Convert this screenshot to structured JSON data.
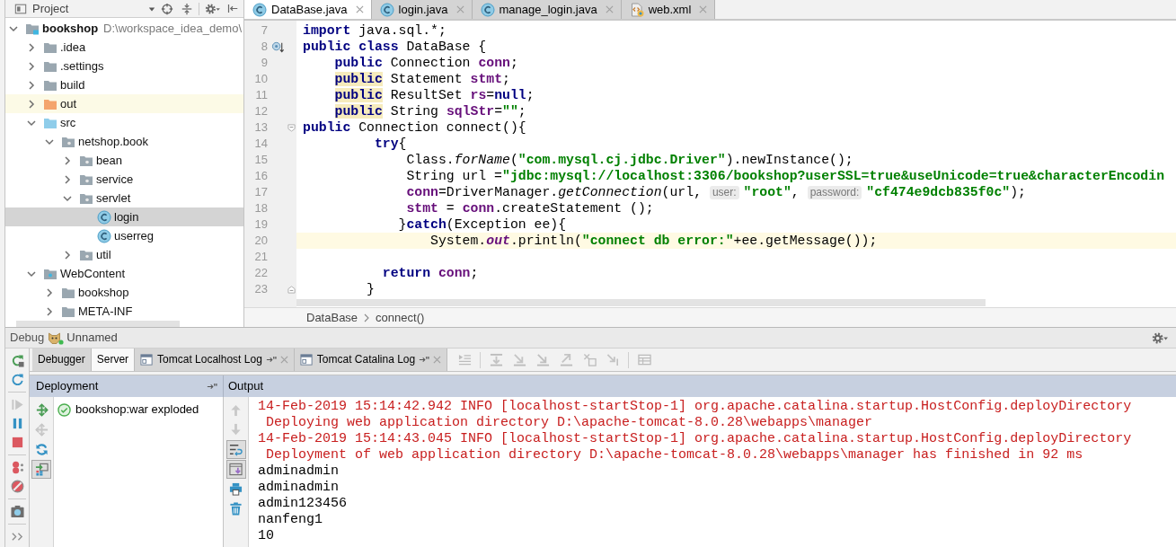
{
  "project_panel": {
    "title": "Project",
    "tree": [
      {
        "label": "bookshop",
        "path": "D:\\workspace_idea_demo\\",
        "kind": "module",
        "expanded": true,
        "selected": false,
        "highlighted": false,
        "children": [
          {
            "label": ".idea",
            "kind": "folder",
            "expanded": false,
            "selected": false,
            "highlighted": false
          },
          {
            "label": ".settings",
            "kind": "folder",
            "expanded": false,
            "selected": false,
            "highlighted": false
          },
          {
            "label": "build",
            "kind": "folder",
            "expanded": false,
            "selected": false,
            "highlighted": false
          },
          {
            "label": "out",
            "kind": "excluded",
            "expanded": false,
            "selected": false,
            "highlighted": true
          },
          {
            "label": "src",
            "kind": "source",
            "expanded": true,
            "selected": false,
            "highlighted": false,
            "children": [
              {
                "label": "netshop.book",
                "kind": "package",
                "expanded": true,
                "selected": false,
                "highlighted": false,
                "children": [
                  {
                    "label": "bean",
                    "kind": "package",
                    "expanded": false,
                    "selected": false,
                    "highlighted": false
                  },
                  {
                    "label": "service",
                    "kind": "package",
                    "expanded": false,
                    "selected": false,
                    "highlighted": false
                  },
                  {
                    "label": "servlet",
                    "kind": "package",
                    "expanded": true,
                    "selected": false,
                    "highlighted": false,
                    "children": [
                      {
                        "label": "login",
                        "kind": "class",
                        "selected": true,
                        "highlighted": false
                      },
                      {
                        "label": "userreg",
                        "kind": "class",
                        "selected": false,
                        "highlighted": false
                      }
                    ]
                  },
                  {
                    "label": "util",
                    "kind": "package",
                    "expanded": false,
                    "selected": false,
                    "highlighted": false
                  }
                ]
              }
            ]
          },
          {
            "label": "WebContent",
            "kind": "web",
            "expanded": true,
            "selected": false,
            "highlighted": false,
            "children": [
              {
                "label": "bookshop",
                "kind": "folder",
                "expanded": false,
                "selected": false,
                "highlighted": false
              },
              {
                "label": "META-INF",
                "kind": "folder",
                "expanded": false,
                "selected": false,
                "highlighted": false
              }
            ]
          }
        ]
      }
    ]
  },
  "editor": {
    "tabs": [
      {
        "label": "DataBase.java",
        "kind": "java",
        "selected": true
      },
      {
        "label": "login.java",
        "kind": "java",
        "selected": false
      },
      {
        "label": "manage_login.java",
        "kind": "java",
        "selected": false
      },
      {
        "label": "web.xml",
        "kind": "xml",
        "selected": false
      }
    ],
    "lines": [
      {
        "number": "7",
        "kind": "plain",
        "current": false,
        "tokens": [
          {
            "kind": "keyword",
            "text": "import"
          },
          {
            "kind": "plain",
            "text": " java.sql.*;"
          }
        ]
      },
      {
        "number": "8",
        "kind": "override",
        "current": false,
        "tokens": [
          {
            "kind": "keyword",
            "text": "public class"
          },
          {
            "kind": "plain",
            "text": " DataBase {"
          }
        ]
      },
      {
        "number": "9",
        "kind": "plain",
        "current": false,
        "tokens": [
          {
            "kind": "keyword",
            "text": "    public"
          },
          {
            "kind": "plain",
            "text": " Connection "
          },
          {
            "kind": "field",
            "text": "conn"
          },
          {
            "kind": "plain",
            "text": ";"
          }
        ]
      },
      {
        "number": "10",
        "kind": "plain",
        "current": false,
        "tokens": [
          {
            "kind": "flagged",
            "text": "    public"
          },
          {
            "kind": "plain",
            "text": " Statement "
          },
          {
            "kind": "field",
            "text": "stmt"
          },
          {
            "kind": "plain",
            "text": ";"
          }
        ]
      },
      {
        "number": "11",
        "kind": "plain",
        "current": false,
        "tokens": [
          {
            "kind": "flagged",
            "text": "    public"
          },
          {
            "kind": "plain",
            "text": " ResultSet "
          },
          {
            "kind": "field",
            "text": "rs"
          },
          {
            "kind": "plain",
            "text": "="
          },
          {
            "kind": "keyword",
            "text": "null"
          },
          {
            "kind": "plain",
            "text": ";"
          }
        ]
      },
      {
        "number": "12",
        "kind": "plain",
        "current": false,
        "tokens": [
          {
            "kind": "flagged",
            "text": "    public"
          },
          {
            "kind": "plain",
            "text": " String "
          },
          {
            "kind": "field",
            "text": "sqlStr"
          },
          {
            "kind": "plain",
            "text": "="
          },
          {
            "kind": "string",
            "text": "\"\""
          },
          {
            "kind": "plain",
            "text": ";"
          }
        ]
      },
      {
        "number": "13",
        "kind": "fold-start",
        "current": false,
        "tokens": [
          {
            "kind": "keyword",
            "text": "public"
          },
          {
            "kind": "plain",
            "text": " Connection connect(){"
          }
        ]
      },
      {
        "number": "14",
        "kind": "plain",
        "current": false,
        "tokens": [
          {
            "kind": "keyword",
            "text": "         try"
          },
          {
            "kind": "plain",
            "text": "{"
          }
        ]
      },
      {
        "number": "15",
        "kind": "plain",
        "current": false,
        "tokens": [
          {
            "kind": "plain",
            "text": "             Class."
          },
          {
            "kind": "method",
            "text": "forName"
          },
          {
            "kind": "plain",
            "text": "("
          },
          {
            "kind": "string",
            "text": "\"com.mysql.cj.jdbc.Driver\""
          },
          {
            "kind": "plain",
            "text": ").newInstance();"
          }
        ]
      },
      {
        "number": "16",
        "kind": "plain",
        "current": false,
        "tokens": [
          {
            "kind": "plain",
            "text": "             String url ="
          },
          {
            "kind": "string",
            "text": "\"jdbc:mysql://localhost:3306/bookshop?userSSL=true&useUnicode=true&characterEncodin"
          }
        ]
      },
      {
        "number": "17",
        "kind": "plain",
        "current": false,
        "tokens": [
          {
            "kind": "field",
            "text": "             conn"
          },
          {
            "kind": "plain",
            "text": "=DriverManager."
          },
          {
            "kind": "method",
            "text": "getConnection"
          },
          {
            "kind": "plain",
            "text": "(url, "
          },
          {
            "kind": "hint",
            "text": "user:"
          },
          {
            "kind": "string",
            "text": "\"root\""
          },
          {
            "kind": "plain",
            "text": ", "
          },
          {
            "kind": "hint",
            "text": "password:"
          },
          {
            "kind": "string",
            "text": "\"cf474e9dcb835f0c\""
          },
          {
            "kind": "plain",
            "text": ");"
          }
        ]
      },
      {
        "number": "18",
        "kind": "plain",
        "current": false,
        "tokens": [
          {
            "kind": "field",
            "text": "             stmt"
          },
          {
            "kind": "plain",
            "text": " = "
          },
          {
            "kind": "field",
            "text": "conn"
          },
          {
            "kind": "plain",
            "text": ".createStatement ();"
          }
        ]
      },
      {
        "number": "19",
        "kind": "plain",
        "current": false,
        "tokens": [
          {
            "kind": "plain",
            "text": "            }"
          },
          {
            "kind": "keyword",
            "text": "catch"
          },
          {
            "kind": "plain",
            "text": "(Exception ee){"
          }
        ]
      },
      {
        "number": "20",
        "kind": "plain",
        "current": true,
        "tokens": [
          {
            "kind": "plain",
            "text": "                System."
          },
          {
            "kind": "static",
            "text": "out"
          },
          {
            "kind": "plain",
            "text": ".println("
          },
          {
            "kind": "string",
            "text": "\"connect db error:\""
          },
          {
            "kind": "plain",
            "text": "+ee.getMessage());"
          }
        ]
      },
      {
        "number": "21",
        "kind": "plain",
        "current": false
      },
      {
        "number": "22",
        "kind": "plain",
        "current": false,
        "tokens": [
          {
            "kind": "keyword",
            "text": "          return"
          },
          {
            "kind": "field",
            "text": " conn"
          },
          {
            "kind": "plain",
            "text": ";"
          }
        ]
      },
      {
        "number": "23",
        "kind": "fold-end",
        "current": false,
        "tokens": [
          {
            "kind": "plain",
            "text": "        }"
          }
        ]
      }
    ],
    "breadcrumb": [
      "DataBase",
      "connect()"
    ]
  },
  "debug": {
    "title": "Debug",
    "config": "Unnamed",
    "toolbar": [
      [
        {
          "kind": "rerun",
          "disabled": false
        },
        {
          "kind": "restart",
          "disabled": false
        }
      ],
      [
        {
          "kind": "resume",
          "disabled": true
        },
        {
          "kind": "pause",
          "disabled": false
        },
        {
          "kind": "stop",
          "disabled": false
        }
      ],
      [
        {
          "kind": "breakpoints",
          "disabled": false
        },
        {
          "kind": "mute",
          "disabled": false
        }
      ],
      [
        {
          "kind": "snapshot",
          "disabled": false
        }
      ],
      [
        {
          "kind": "more",
          "disabled": false
        }
      ]
    ],
    "tabs": [
      {
        "label": "Debugger",
        "kind": "plain",
        "selected": false
      },
      {
        "label": "Server",
        "kind": "plain",
        "selected": true
      },
      {
        "label": "Tomcat Localhost Log",
        "kind": "log",
        "selected": false
      },
      {
        "label": "Tomcat Catalina Log",
        "kind": "log",
        "selected": false
      }
    ],
    "step_toolbar": [
      [
        {
          "kind": "execution-point",
          "disabled": true
        }
      ],
      [
        {
          "kind": "step-over",
          "disabled": true
        },
        {
          "kind": "step-into",
          "disabled": true
        },
        {
          "kind": "force-step-into",
          "disabled": true
        },
        {
          "kind": "step-out",
          "disabled": true
        },
        {
          "kind": "drop-frame",
          "disabled": true
        },
        {
          "kind": "run-to-cursor",
          "disabled": true
        }
      ],
      [
        {
          "kind": "evaluate",
          "disabled": true
        }
      ]
    ],
    "deployment": {
      "title": "Deployment",
      "toolbar": [
        {
          "kind": "deploy",
          "disabled": false,
          "on": false
        },
        {
          "kind": "undeploy",
          "disabled": true,
          "on": false
        },
        {
          "kind": "update",
          "disabled": false,
          "on": false
        },
        {
          "kind": "deployment-view",
          "disabled": false,
          "on": true
        }
      ],
      "items": [
        {
          "label": "bookshop:war exploded",
          "deployed": true
        }
      ]
    },
    "output": {
      "title": "Output",
      "toolbar": [
        {
          "kind": "up",
          "disabled": true,
          "on": false
        },
        {
          "kind": "down",
          "disabled": true,
          "on": false
        },
        {
          "kind": "soft-wrap",
          "disabled": false,
          "on": true
        },
        {
          "kind": "scroll-end",
          "disabled": false,
          "on": true
        },
        {
          "kind": "print",
          "disabled": false,
          "on": false
        },
        {
          "kind": "clear",
          "disabled": false,
          "on": false
        }
      ],
      "lines": [
        {
          "kind": "log",
          "text": "14-Feb-2019 15:14:42.942 INFO [localhost-startStop-1] org.apache.catalina.startup.HostConfig.deployDirectory"
        },
        {
          "kind": "log",
          "text": " Deploying web application directory D:\\apache-tomcat-8.0.28\\webapps\\manager"
        },
        {
          "kind": "log",
          "text": "14-Feb-2019 15:14:43.045 INFO [localhost-startStop-1] org.apache.catalina.startup.HostConfig.deployDirectory"
        },
        {
          "kind": "log",
          "text": " Deployment of web application directory D:\\apache-tomcat-8.0.28\\webapps\\manager has finished in 92 ms"
        },
        {
          "kind": "stdout",
          "text": "adminadmin"
        },
        {
          "kind": "stdout",
          "text": "adminadmin"
        },
        {
          "kind": "stdout",
          "text": "admin123456"
        },
        {
          "kind": "stdout",
          "text": "nanfeng1"
        },
        {
          "kind": "stdout",
          "text": "10"
        }
      ]
    }
  }
}
